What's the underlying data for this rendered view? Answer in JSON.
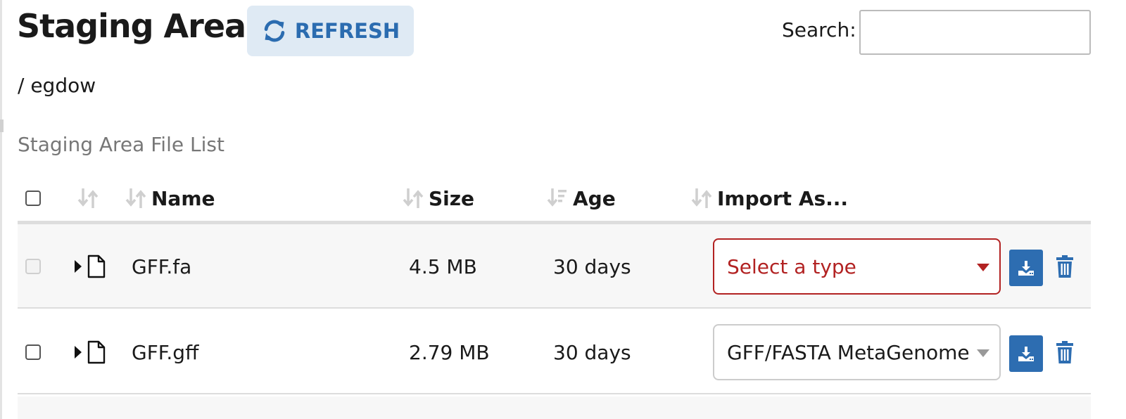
{
  "page": {
    "title": "Staging Area",
    "refresh_label": "REFRESH",
    "search_label": "Search:",
    "search_value": "",
    "path": "/ egdow",
    "caption": "Staging Area File List"
  },
  "table": {
    "columns": [
      "",
      "",
      "Name",
      "Size",
      "Age",
      "Import As..."
    ],
    "rows": [
      {
        "name": "GFF.fa",
        "size": "4.5 MB",
        "age": "30 days",
        "import_as": "Select a type",
        "import_state": "invalid",
        "selectable": false
      },
      {
        "name": "GFF.gff",
        "size": "2.79 MB",
        "age": "30 days",
        "import_as": "GFF/FASTA MetaGenome",
        "import_state": "valid",
        "selectable": true
      }
    ]
  },
  "colors": {
    "accent": "#2d6db1",
    "refresh_bg": "#dfeaf4",
    "refresh_text": "#2b6cb0",
    "error": "#b22222",
    "row_stripe": "#f7f7f7"
  },
  "icons": {
    "refresh": "refresh-icon",
    "sort": "sort-icon",
    "sort_active": "sort-desc-icon",
    "expand": "caret-right-icon",
    "file": "file-icon",
    "import": "import-icon",
    "delete": "trash-icon"
  }
}
